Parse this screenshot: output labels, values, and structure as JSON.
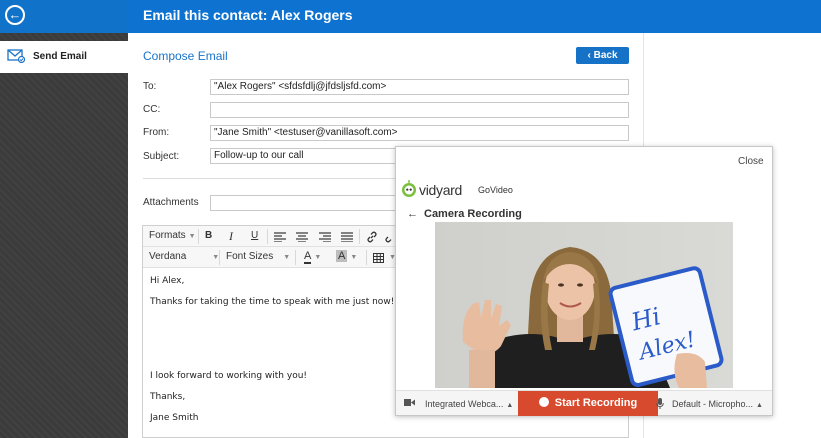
{
  "header": {
    "title": "Email this contact: Alex Rogers"
  },
  "sidebar": {
    "items": [
      {
        "label": "Send Email",
        "icon": "envelope-icon"
      }
    ]
  },
  "compose": {
    "title": "Compose Email",
    "back_label": "Back",
    "fields": {
      "to_label": "To:",
      "to_value": "\"Alex Rogers\" <sfdsfdlj@jfdsljsfd.com>",
      "cc_label": "CC:",
      "cc_value": "",
      "from_label": "From:",
      "from_value": "\"Jane Smith\" <testuser@vanillasoft.com>",
      "subject_label": "Subject:",
      "subject_value": "Follow-up to our call",
      "attachments_label": "Attachments"
    }
  },
  "editor": {
    "toolbar": {
      "formats": "Formats",
      "bold": "B",
      "italic": "I",
      "underline": "U",
      "font": "Verdana",
      "font_sizes": "Font Sizes"
    },
    "body_lines": [
      "Hi Alex,",
      "Thanks for taking the time to speak with me just now! Plea",
      "I look forward to working with you!",
      "Thanks,",
      "Jane Smith"
    ]
  },
  "vidyard": {
    "close_label": "Close",
    "brand": "vidyard",
    "product": "GoVideo",
    "section_title": "Camera Recording",
    "video_sign_text": "Hi Alex!",
    "camera_select": "Integrated Webca...",
    "start_recording_label": "Start Recording",
    "mic_select": "Default - Micropho...",
    "colors": {
      "record_button": "#d84a2d",
      "brand_green": "#7bbf3f"
    }
  },
  "colors": {
    "header_blue": "#0e73d0",
    "accent_blue": "#1a73c8",
    "sidebar_dark": "#3b3b3b"
  }
}
